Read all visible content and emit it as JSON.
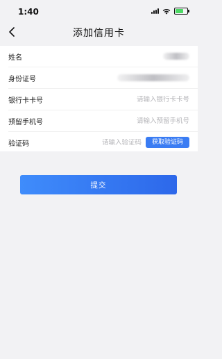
{
  "status_bar": {
    "time": "1:40",
    "battery_color": "#4cd964",
    "icons": [
      "signal-icon",
      "wifi-icon",
      "battery-icon"
    ]
  },
  "nav": {
    "back_icon": "chevron-left-icon",
    "title": "添加信用卡"
  },
  "form": {
    "name_label": "姓名",
    "id_label": "身份证号",
    "card_label": "银行卡卡号",
    "card_placeholder": "请输入银行卡卡号",
    "phone_label": "预留手机号",
    "phone_placeholder": "请输入预留手机号",
    "code_label": "验证码",
    "code_placeholder": "请输入验证码",
    "get_code_label": "获取验证码"
  },
  "submit_label": "提交",
  "colors": {
    "accent": "#3a7cf3",
    "background": "#f2f2f4"
  }
}
